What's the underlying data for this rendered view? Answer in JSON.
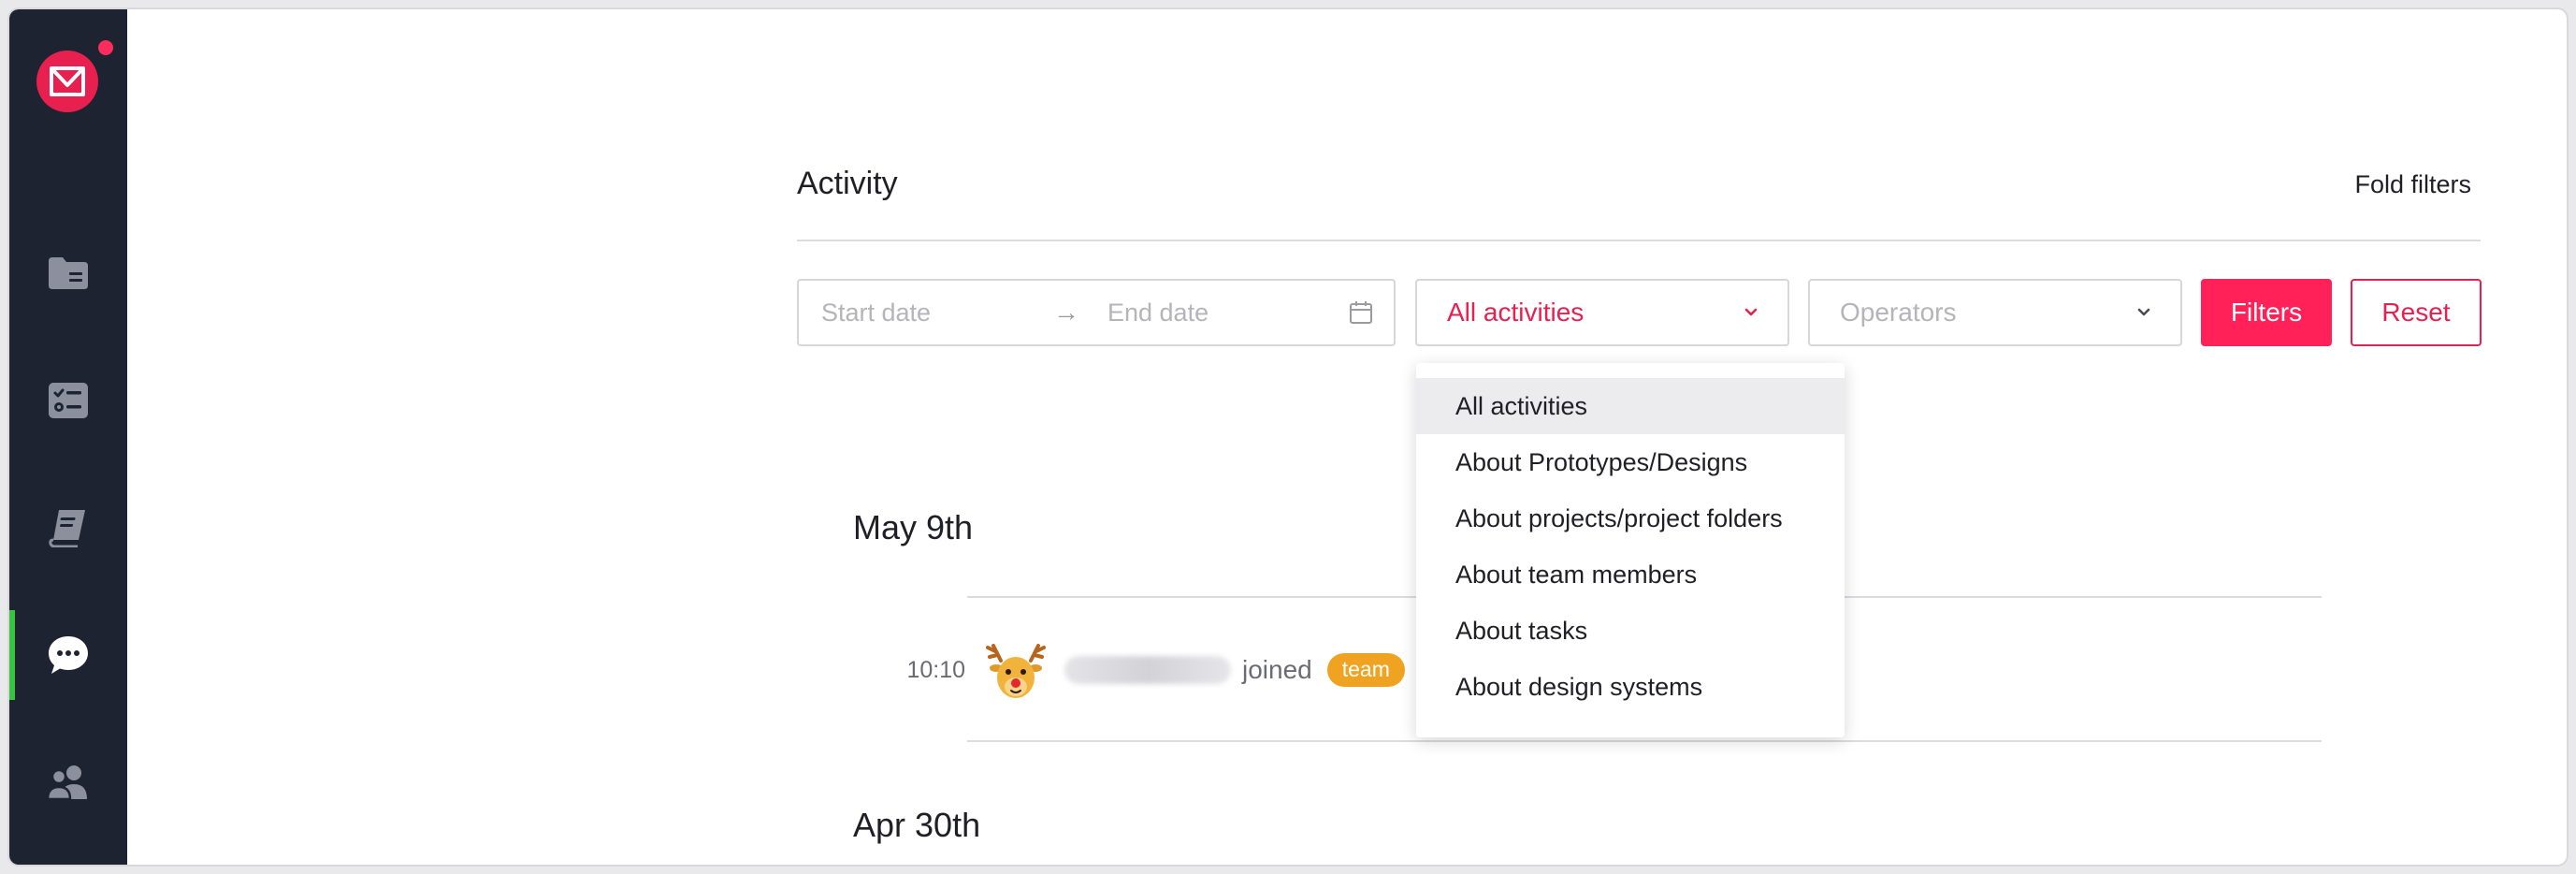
{
  "sidebar": {
    "logo_icon": "brand-logo-icon",
    "logo_color": "#e8204f",
    "items": [
      {
        "icon": "folder-icon",
        "active": false
      },
      {
        "icon": "task-list-icon",
        "active": false
      },
      {
        "icon": "book-icon",
        "active": false
      },
      {
        "icon": "chat-bubble-icon",
        "active": true
      },
      {
        "icon": "team-members-icon",
        "active": false
      }
    ],
    "active_indicator_color": "#39c23f"
  },
  "header": {
    "title": "Activity",
    "fold_filters_label": "Fold filters"
  },
  "filters": {
    "start_date_placeholder": "Start date",
    "end_date_placeholder": "End date",
    "activity_select_value": "All activities",
    "operators_select_placeholder": "Operators",
    "filters_button_label": "Filters",
    "reset_button_label": "Reset",
    "accent_color": "#ff2158"
  },
  "activity_dropdown": {
    "options": [
      {
        "label": "All activities",
        "selected": true
      },
      {
        "label": "About Prototypes/Designs",
        "selected": false
      },
      {
        "label": "About projects/project folders",
        "selected": false
      },
      {
        "label": "About team members",
        "selected": false
      },
      {
        "label": "About tasks",
        "selected": false
      },
      {
        "label": "About design systems",
        "selected": false
      }
    ]
  },
  "timeline": {
    "groups": [
      {
        "date": "May 9th",
        "entries": [
          {
            "time": "10:10",
            "avatar_icon": "reindeer-avatar-icon",
            "action": "joined",
            "badge": "team",
            "badge_color": "#f0a320"
          }
        ]
      },
      {
        "date": "Apr 30th",
        "entries": []
      }
    ]
  }
}
